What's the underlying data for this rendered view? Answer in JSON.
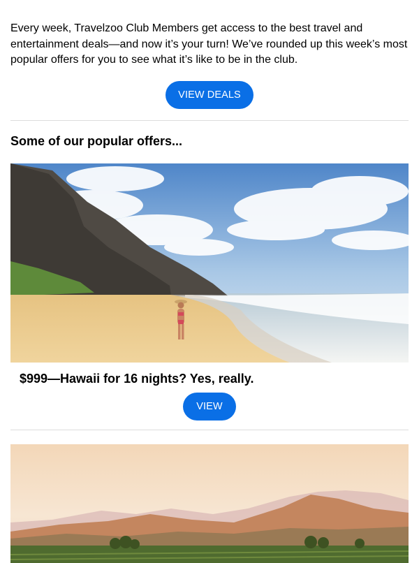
{
  "intro": {
    "text": "Every week, Travelzoo Club Members get access to the best travel and entertainment deals—and now it’s your turn! We’ve rounded up this week’s most popular offers for you to see what it’s like to be in the club."
  },
  "cta": {
    "view_deals_label": "VIEW DEALS"
  },
  "section": {
    "title": "Some of our popular offers..."
  },
  "offers": [
    {
      "title": "$999—Hawaii for 16 nights? Yes, really.",
      "button_label": "VIEW"
    }
  ],
  "colors": {
    "button": "#0a6fe6",
    "divider": "#dddddd"
  }
}
